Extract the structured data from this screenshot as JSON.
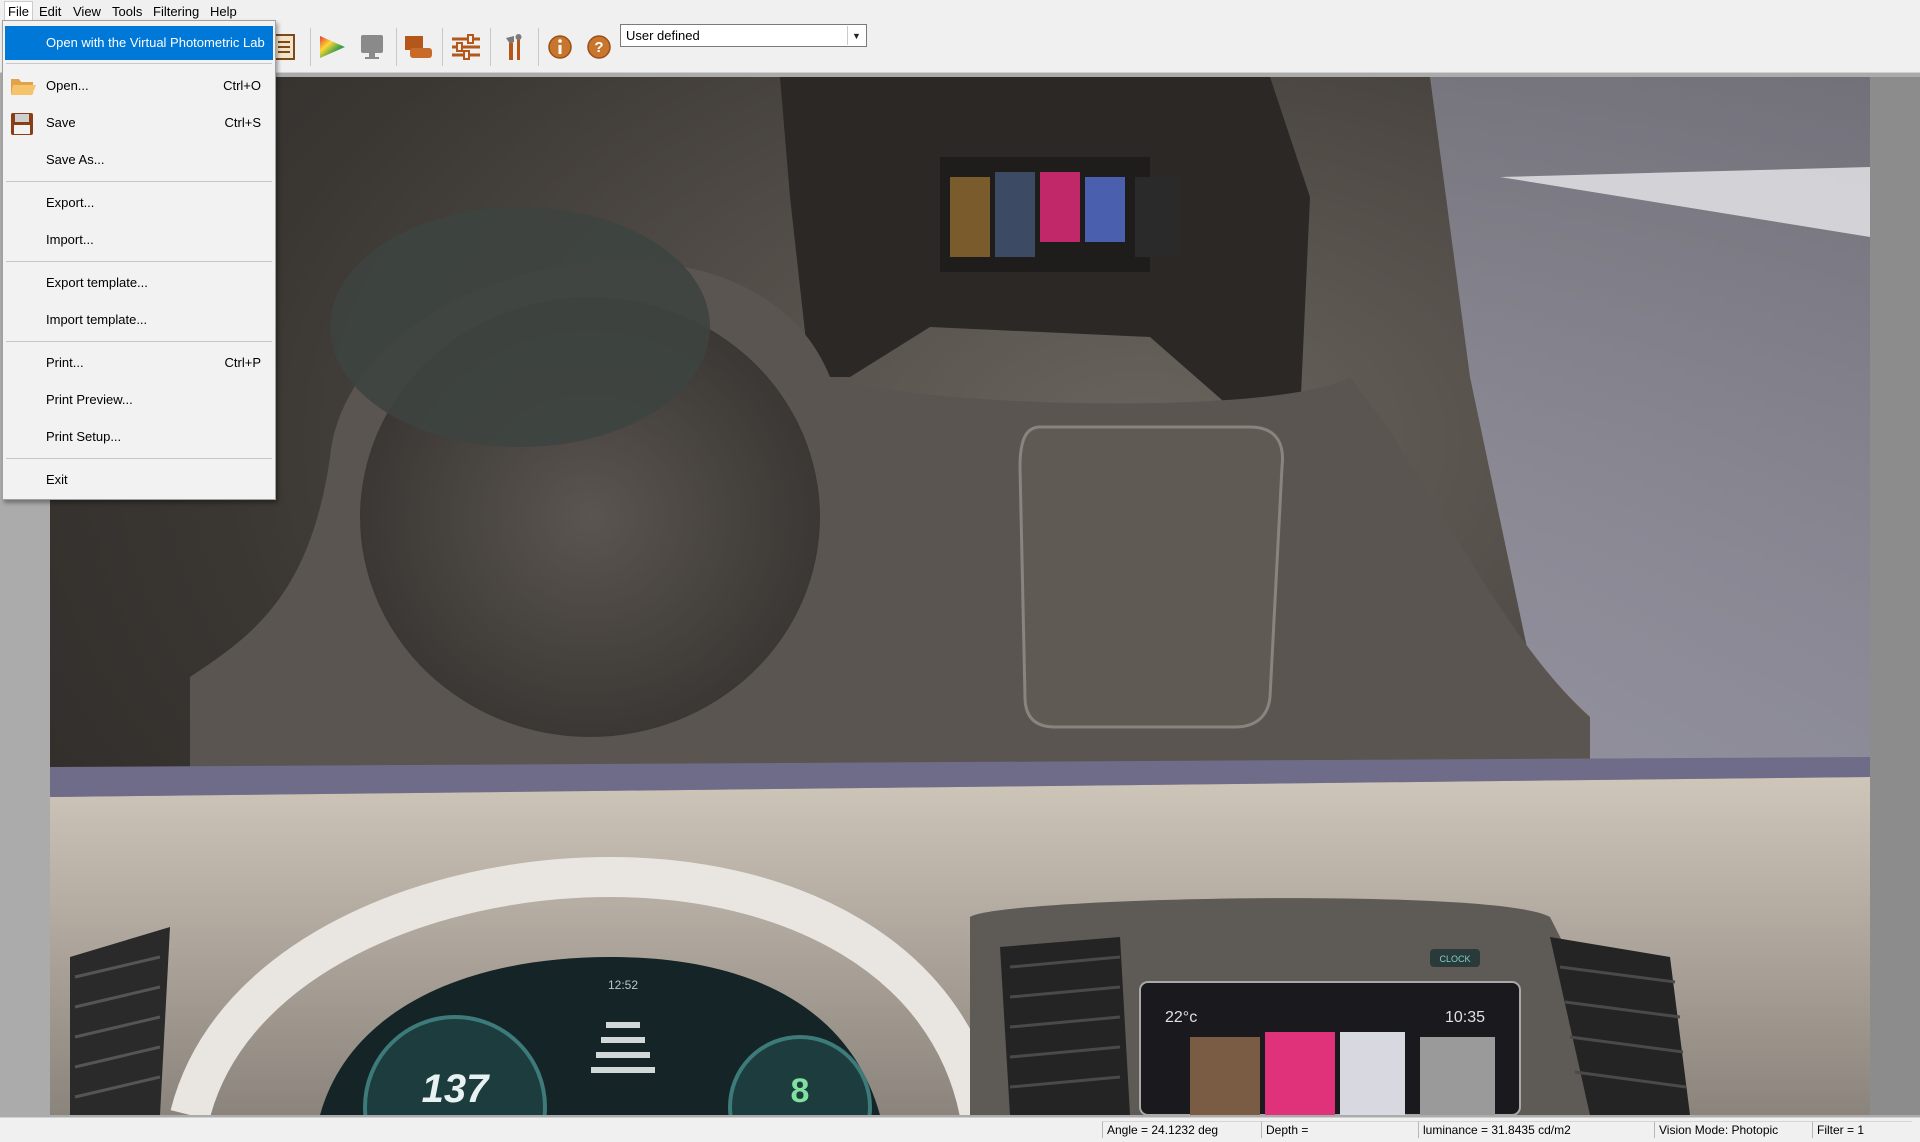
{
  "menubar": {
    "items": [
      {
        "label": "File",
        "mnemonic": "F"
      },
      {
        "label": "Edit",
        "mnemonic": "E"
      },
      {
        "label": "View",
        "mnemonic": "V"
      },
      {
        "label": "Tools",
        "mnemonic": "T"
      },
      {
        "label": "Filtering",
        "mnemonic": "F"
      },
      {
        "label": "Help",
        "mnemonic": "H"
      }
    ]
  },
  "toolbar": {
    "icons": [
      "save-icon",
      "document-icon",
      "color-triangle-icon",
      "monitor-icon",
      "display-icon",
      "sliders-icon",
      "tools-icon",
      "info-icon",
      "help-icon"
    ],
    "preset_select": {
      "value": "User defined"
    }
  },
  "file_menu": {
    "items": [
      {
        "label": "Open with the Virtual Photometric Lab",
        "shortcut": "",
        "highlighted": true
      },
      {
        "label": "Open...",
        "shortcut": "Ctrl+O",
        "icon": "open-folder-icon"
      },
      {
        "label": "Save",
        "shortcut": "Ctrl+S",
        "icon": "floppy-disk-icon"
      },
      {
        "label": "Save As...",
        "shortcut": ""
      },
      {
        "label": "Export...",
        "shortcut": ""
      },
      {
        "label": "Import...",
        "shortcut": ""
      },
      {
        "label": "Export template...",
        "shortcut": ""
      },
      {
        "label": "Import template...",
        "shortcut": ""
      },
      {
        "label": "Print...",
        "shortcut": "Ctrl+P"
      },
      {
        "label": "Print Preview...",
        "shortcut": ""
      },
      {
        "label": "Print Setup...",
        "shortcut": ""
      },
      {
        "label": "Exit",
        "shortcut": ""
      }
    ]
  },
  "viewport": {
    "cluster_speed": "137",
    "cluster_gear": "8",
    "cluster_time": "12:52",
    "screen_temp": "22°c",
    "screen_time": "10:35",
    "clock_button": "CLOCK"
  },
  "statusbar": {
    "angle": "Angle = 24.1232 deg",
    "depth": "Depth =",
    "luminance": "luminance = 31.8435 cd/m2",
    "vision_mode": "Vision Mode: Photopic",
    "filter": "Filter = 1"
  },
  "colors": {
    "menu_highlight": "#0078d7",
    "chrome": "#f0f0f0"
  }
}
